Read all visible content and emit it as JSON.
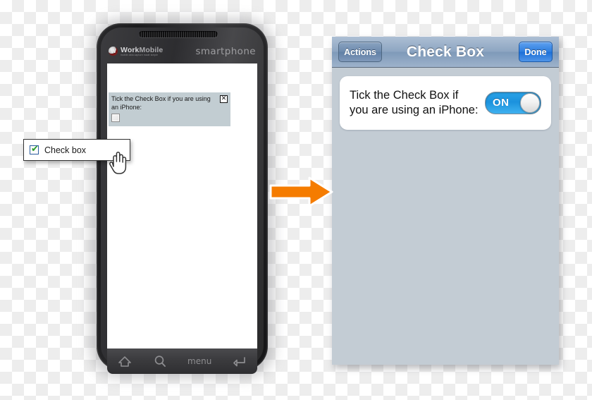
{
  "android": {
    "brand": {
      "logo_icon": "work-mobile-logo-icon",
      "name_bold": "Work",
      "name_light": "Mobile",
      "tagline": "mobile data capture made simple",
      "model_text": "smartphone"
    },
    "form": {
      "prompt": "Tick the Check Box if you are using an iPhone:",
      "close_label": "☒",
      "checkbox_checked": false
    },
    "navbar": {
      "home_icon": "home-icon",
      "search_icon": "search-icon",
      "menu_label": "menu",
      "back_icon": "back-arrow-icon"
    }
  },
  "tooltip": {
    "label": "Check box",
    "checkbox_checked": true,
    "check_glyph": "✔",
    "cursor_icon": "hand-pointer-cursor"
  },
  "arrow": {
    "icon": "right-arrow-icon",
    "color": "#F57C00"
  },
  "ios": {
    "navbar": {
      "left_button": "Actions",
      "title": "Check Box",
      "right_button": "Done"
    },
    "card": {
      "label": "Tick the Check Box if you are using an iPhone:",
      "toggle_state": "ON"
    }
  },
  "colors": {
    "ios_panel_bg": "#C3CCD4",
    "android_form_bg": "#C2CDD2",
    "accent_orange": "#F57C00",
    "toggle_blue": "#1C92DD",
    "done_blue": "#2F7FE0"
  }
}
